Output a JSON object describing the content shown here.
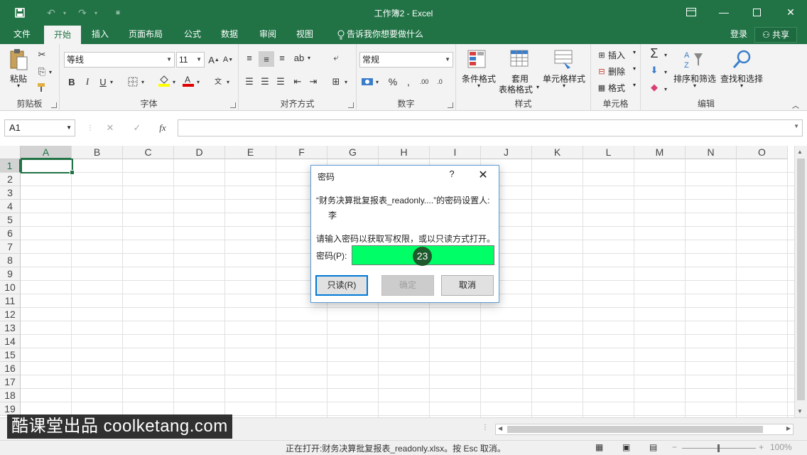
{
  "window": {
    "title": "工作簿2 - Excel"
  },
  "menu": {
    "tabs": [
      "文件",
      "开始",
      "插入",
      "页面布局",
      "公式",
      "数据",
      "审阅",
      "视图"
    ],
    "active": "开始",
    "tell_me": "告诉我你想要做什么",
    "sign_in": "登录",
    "share": "共享"
  },
  "ribbon": {
    "clipboard": {
      "label": "剪贴板",
      "paste": "粘贴"
    },
    "font": {
      "label": "字体",
      "name": "等线",
      "size": "11"
    },
    "alignment": {
      "label": "对齐方式"
    },
    "number": {
      "label": "数字",
      "format": "常规"
    },
    "styles": {
      "label": "样式",
      "conditional": "条件格式",
      "table_line1": "套用",
      "table_line2": "表格格式",
      "cell_styles": "单元格样式"
    },
    "cells": {
      "label": "单元格",
      "insert": "插入",
      "delete": "删除",
      "format": "格式"
    },
    "editing": {
      "label": "编辑",
      "sort_filter": "排序和筛选",
      "find_select": "查找和选择"
    }
  },
  "formula_bar": {
    "name_box": "A1",
    "fx": "fx"
  },
  "grid": {
    "columns": [
      "A",
      "B",
      "C",
      "D",
      "E",
      "F",
      "G",
      "H",
      "I",
      "J",
      "K",
      "L",
      "M",
      "N",
      "O"
    ],
    "rows": [
      "1",
      "2",
      "3",
      "4",
      "5",
      "6",
      "7",
      "8",
      "9",
      "10",
      "11",
      "12",
      "13",
      "14",
      "15",
      "16",
      "17",
      "18",
      "19"
    ],
    "selected_col": "A",
    "selected_row": "1"
  },
  "dialog": {
    "title": "密码",
    "help": "?",
    "message": "“财务决算批复报表_readonly....”的密码设置人:",
    "owner": "李",
    "prompt": "请输入密码以获取写权限，或以只读方式打开。",
    "password_label": "密码(P):",
    "step_badge": "23",
    "buttons": {
      "read_only": "只读(R)",
      "ok": "确定",
      "cancel": "取消"
    }
  },
  "status_bar": {
    "text": "正在打开:财务决算批复报表_readonly.xlsx。按 Esc 取消。",
    "zoom": "100%"
  },
  "watermark": "酷课堂出品 coolketang.com",
  "colors": {
    "accent": "#217346",
    "highlight": "#00ff66"
  }
}
